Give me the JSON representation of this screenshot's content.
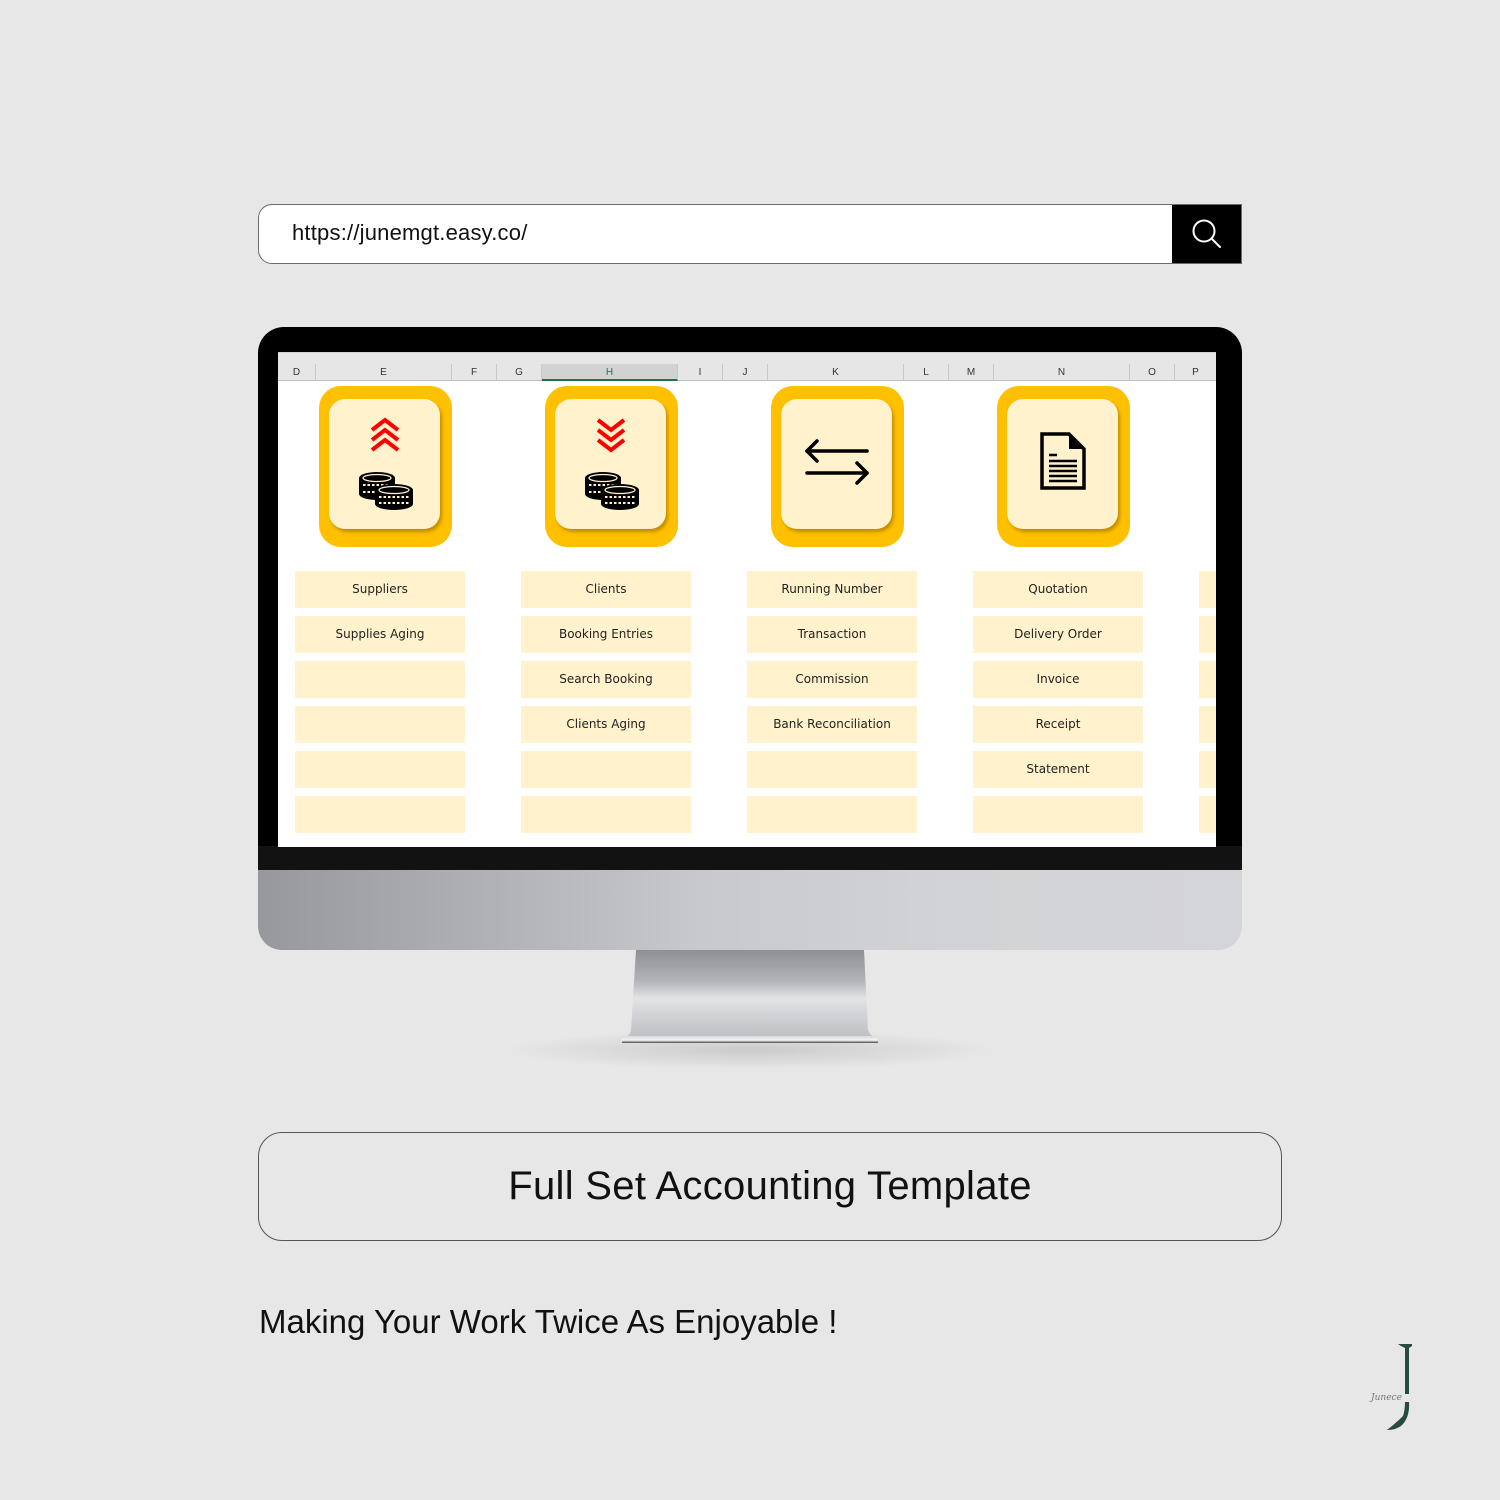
{
  "browser": {
    "url": "https://junemgt.easy.co/",
    "search_icon": "search-icon"
  },
  "spreadsheet": {
    "column_headers": [
      {
        "label": "D",
        "selected": false
      },
      {
        "label": "E",
        "selected": false
      },
      {
        "label": "F",
        "selected": false
      },
      {
        "label": "G",
        "selected": false
      },
      {
        "label": "H",
        "selected": true
      },
      {
        "label": "I",
        "selected": false
      },
      {
        "label": "J",
        "selected": false
      },
      {
        "label": "K",
        "selected": false
      },
      {
        "label": "L",
        "selected": false
      },
      {
        "label": "M",
        "selected": false
      },
      {
        "label": "N",
        "selected": false
      },
      {
        "label": "O",
        "selected": false
      },
      {
        "label": "P",
        "selected": false
      }
    ],
    "colors": {
      "tile_outer": "#ffc000",
      "tile_inner": "#fff2cc",
      "button_fill": "#fff2cc",
      "arrow_red": "#ff0000",
      "selected_header": "#217346"
    },
    "modules": [
      {
        "icon": "coins-up-icon",
        "buttons": [
          "Suppliers",
          "Supplies Aging",
          "",
          "",
          "",
          ""
        ]
      },
      {
        "icon": "coins-down-icon",
        "buttons": [
          "Clients",
          "Booking Entries",
          "Search Booking",
          "Clients Aging",
          "",
          ""
        ]
      },
      {
        "icon": "exchange-arrows-icon",
        "buttons": [
          "Running Number",
          "Transaction",
          "Commission",
          "Bank Reconciliation",
          "",
          ""
        ]
      },
      {
        "icon": "document-icon",
        "buttons": [
          "Quotation",
          "Delivery Order",
          "Invoice",
          "Receipt",
          "Statement",
          ""
        ]
      },
      {
        "icon": "",
        "buttons": [
          "",
          "",
          "",
          "",
          "",
          ""
        ]
      }
    ]
  },
  "title": "Full Set Accounting Template",
  "tagline": "Making Your Work Twice As Enjoyable !",
  "logo": {
    "letter": "J",
    "script_text": "Junece"
  }
}
